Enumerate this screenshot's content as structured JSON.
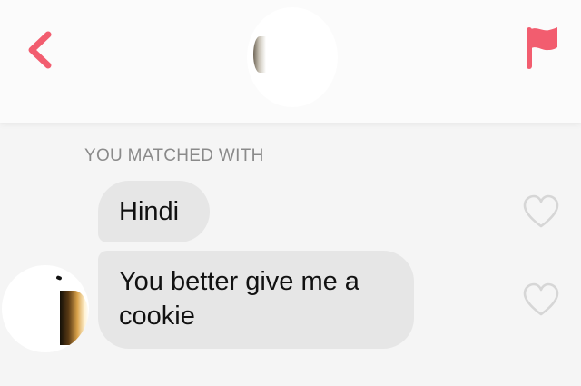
{
  "header": {
    "back_icon": "chevron-left-icon",
    "report_icon": "flag-icon",
    "accent_color": "#f25d6f"
  },
  "match_label": "YOU MATCHED WITH",
  "messages": [
    {
      "text": "Hindi",
      "liked": false
    },
    {
      "text": "You better give me a cookie",
      "liked": false
    }
  ],
  "colors": {
    "background": "#f5f5f5",
    "bubble": "#e6e6e6",
    "muted_text": "#8a8a8a",
    "heart_outline": "#d6d6d6"
  }
}
